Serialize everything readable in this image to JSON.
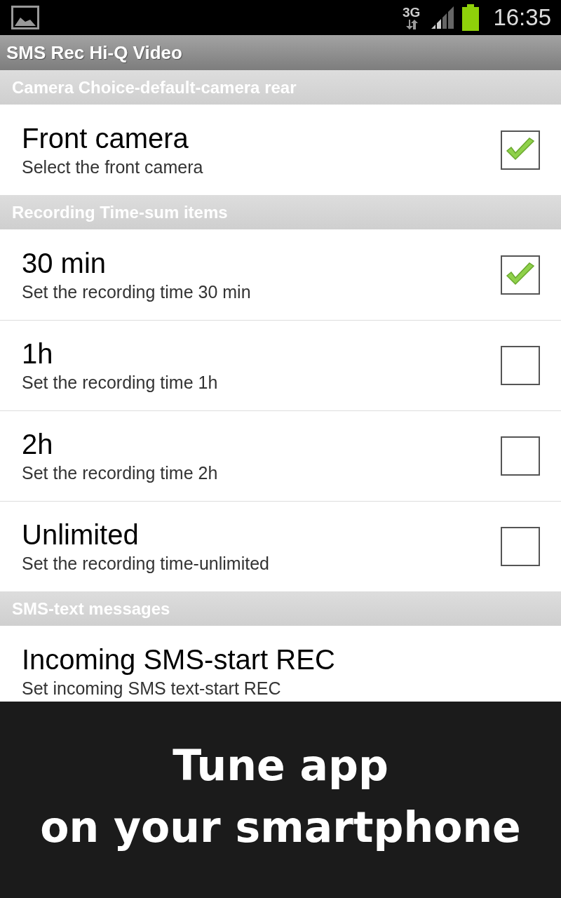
{
  "status_bar": {
    "network": "3G",
    "time": "16:35"
  },
  "app_bar": {
    "title": "SMS Rec Hi-Q Video"
  },
  "sections": [
    {
      "header": "Camera Choice-default-camera rear",
      "items": [
        {
          "kind": "checkbox",
          "title": "Front camera",
          "summary": "Select the front camera",
          "checked": true
        }
      ]
    },
    {
      "header": "Recording Time-sum items",
      "items": [
        {
          "kind": "checkbox",
          "title": "30 min",
          "summary": "Set the recording time 30 min",
          "checked": true
        },
        {
          "kind": "checkbox",
          "title": "1h",
          "summary": "Set the recording time 1h",
          "checked": false
        },
        {
          "kind": "checkbox",
          "title": "2h",
          "summary": "Set the recording time 2h",
          "checked": false
        },
        {
          "kind": "checkbox",
          "title": "Unlimited",
          "summary": "Set the recording time-unlimited",
          "checked": false
        }
      ]
    },
    {
      "header": "SMS-text messages",
      "items": [
        {
          "kind": "plain",
          "title": "Incoming SMS-start REC",
          "summary": "Set incoming SMS text-start REC"
        }
      ]
    }
  ],
  "banner": {
    "lines": [
      "Tune app",
      "on your smartphone"
    ]
  }
}
